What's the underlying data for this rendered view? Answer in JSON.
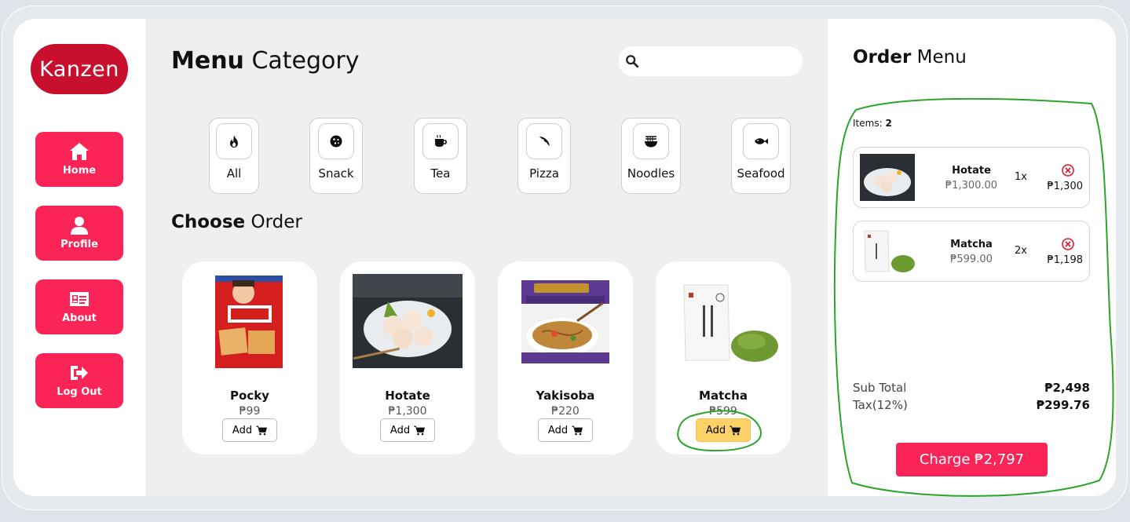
{
  "logo": "Kanzen",
  "nav": [
    {
      "label": "Home",
      "icon": "home-icon"
    },
    {
      "label": "Profile",
      "icon": "user-icon"
    },
    {
      "label": "About",
      "icon": "id-card-icon"
    },
    {
      "label": "Log Out",
      "icon": "logout-icon"
    }
  ],
  "main": {
    "title_bold": "Menu",
    "title_rest": " Category",
    "search_placeholder": "",
    "choose_bold": "Choose",
    "choose_rest": " Order"
  },
  "categories": [
    {
      "label": "All",
      "icon": "fire-icon"
    },
    {
      "label": "Snack",
      "icon": "cookie-icon"
    },
    {
      "label": "Tea",
      "icon": "mug-icon"
    },
    {
      "label": "Pizza",
      "icon": "pizza-icon"
    },
    {
      "label": "Noodles",
      "icon": "noodle-bowl-icon"
    },
    {
      "label": "Seafood",
      "icon": "fish-icon"
    }
  ],
  "products": [
    {
      "name": "Pocky",
      "price": "₱99",
      "add_label": "Add",
      "selected": false
    },
    {
      "name": "Hotate",
      "price": "₱1,300",
      "add_label": "Add",
      "selected": false
    },
    {
      "name": "Yakisoba",
      "price": "₱220",
      "add_label": "Add",
      "selected": false
    },
    {
      "name": "Matcha",
      "price": "₱599",
      "add_label": "Add",
      "selected": true
    }
  ],
  "order": {
    "title_bold": "Order",
    "title_rest": " Menu",
    "items_label": "Items: ",
    "items_count": "2",
    "items": [
      {
        "name": "Hotate",
        "unit_price": "₱1,300.00",
        "qty": "1x",
        "total": "₱1,300"
      },
      {
        "name": "Matcha",
        "unit_price": "₱599.00",
        "qty": "2x",
        "total": "₱1,198"
      }
    ],
    "subtotal_label": "Sub Total",
    "subtotal": "₱2,498",
    "tax_label": "Tax(12%)",
    "tax": "₱299.76",
    "charge_label": "Charge ₱2,797"
  },
  "colors": {
    "accent": "#fb2457",
    "logo_bg": "#c8102e",
    "add_active": "#fcd268",
    "annotation": "#2aa52a"
  }
}
